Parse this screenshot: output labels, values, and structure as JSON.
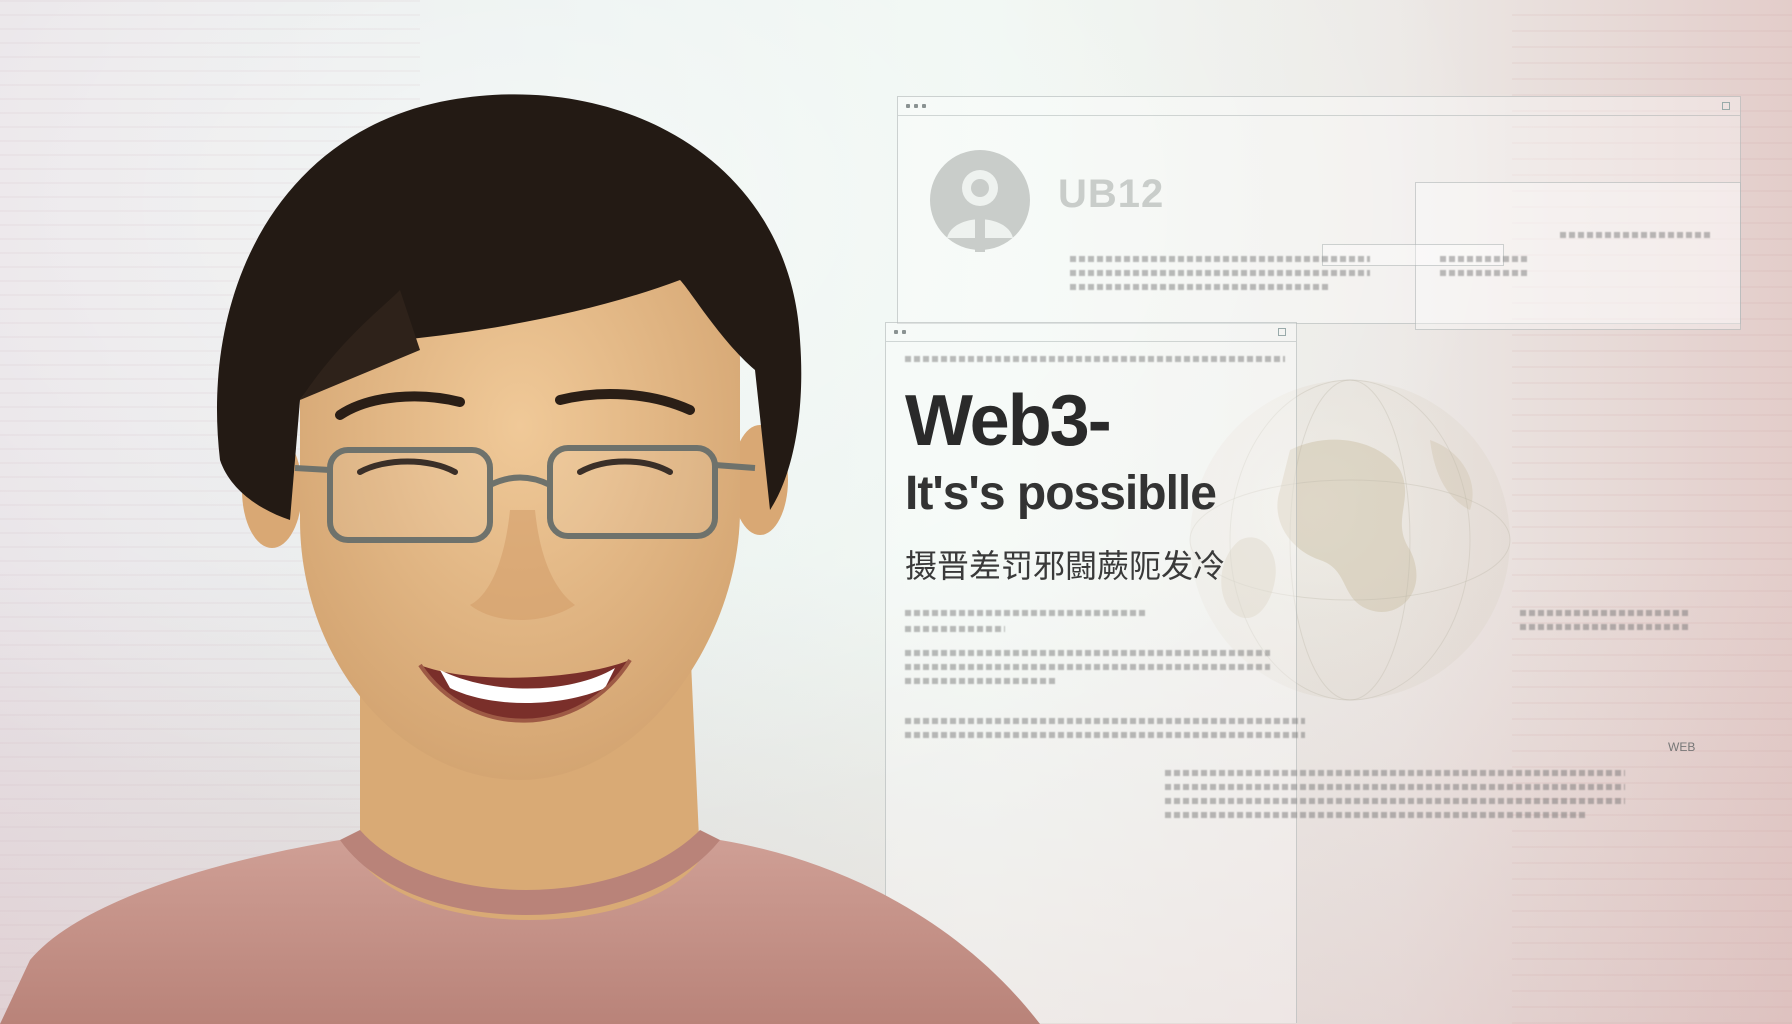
{
  "headline": "Web3-",
  "subline": "It's's possiblle",
  "cjk_title": "摄晋差罚邪闘蕨阨发冷",
  "logo_text": "UB12",
  "corner_label": "WEB",
  "colors": {
    "background_left": "#e7e2e6",
    "background_center": "#eef6f1",
    "background_right": "#e3cdca",
    "headline": "#2a2a2a",
    "shirt": "#c79a90",
    "hair": "#231a14",
    "skin": "#e4b986"
  },
  "subject": "smiling person with glasses"
}
